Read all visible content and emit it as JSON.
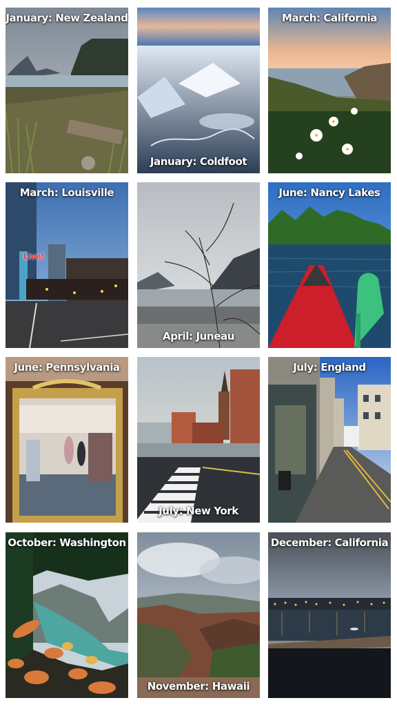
{
  "tiles": [
    {
      "caption": "January: New Zealand"
    },
    {
      "caption": "January: Coldfoot"
    },
    {
      "caption": "March: California"
    },
    {
      "caption": "March: Louisville"
    },
    {
      "caption": "April: Juneau"
    },
    {
      "caption": "June: Nancy Lakes"
    },
    {
      "caption": "June: Pennsylvania"
    },
    {
      "caption": "July: New York"
    },
    {
      "caption": "July: England"
    },
    {
      "caption": "October: Washington"
    },
    {
      "caption": "November: Hawaii"
    },
    {
      "caption": "December: California"
    }
  ],
  "embedded_signs": {
    "louisville_sign": "Live!"
  }
}
